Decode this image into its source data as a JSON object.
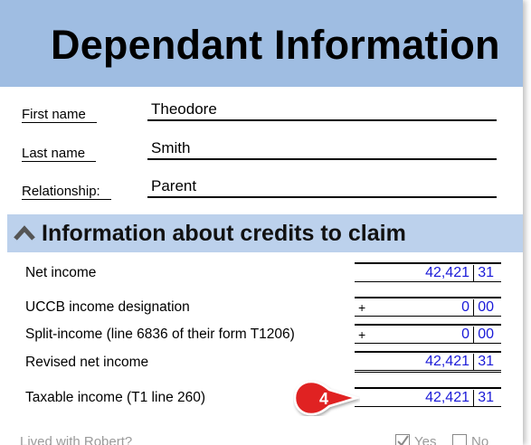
{
  "header": {
    "title": "Dependant Information"
  },
  "fields": [
    {
      "label": "First name",
      "value": "Theodore"
    },
    {
      "label": "Last name",
      "value": "Smith"
    },
    {
      "label": "Relationship:",
      "value": "Parent"
    }
  ],
  "section": {
    "title": "Information about credits to claim",
    "icon": "chevron-up-icon"
  },
  "rows": [
    {
      "label": "Net income",
      "sign": "",
      "dollars": "42,421",
      "cents": "31"
    },
    {
      "label": "UCCB income designation",
      "sign": "+",
      "dollars": "0",
      "cents": "00"
    },
    {
      "label": "Split-income (line 6836 of their form T1206)",
      "sign": "+",
      "dollars": "0",
      "cents": "00"
    },
    {
      "label": "Revised net income",
      "sign": "",
      "dollars": "42,421",
      "cents": "31"
    },
    {
      "label": "Taxable income (T1 line 260)",
      "sign": "",
      "dollars": "42,421",
      "cents": "31"
    }
  ],
  "callout": {
    "number": "4",
    "color": "#e02020"
  },
  "footer": {
    "question": "Lived with Robert?",
    "yes_label": "Yes",
    "no_label": "No",
    "yes_checked": true,
    "no_checked": false
  },
  "colors": {
    "header_bg": "#9fbde2",
    "section_bg": "#bcd1ec",
    "amount_text": "#1a1ad8"
  }
}
